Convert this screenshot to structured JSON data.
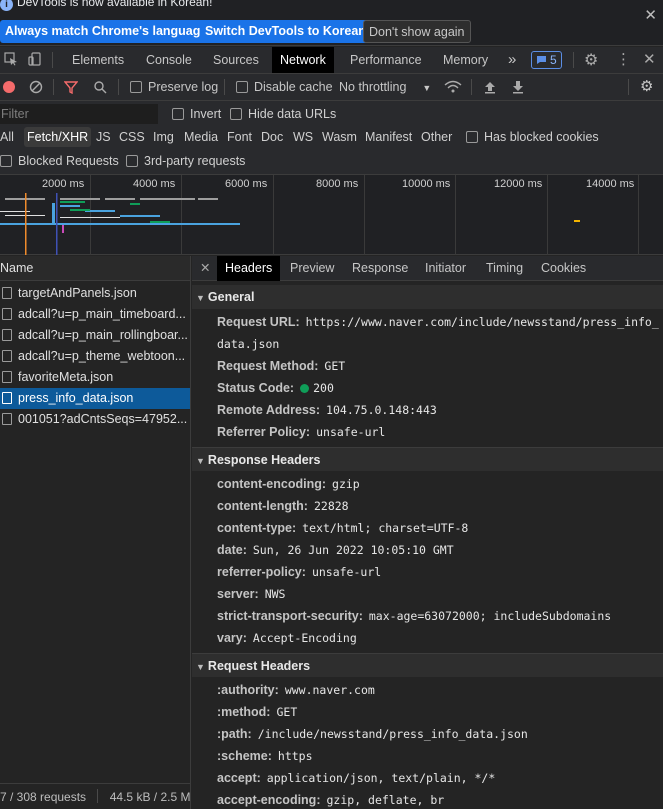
{
  "infobar": {
    "message": "DevTools is now available in Korean!",
    "btn_match": "Always match Chrome's language",
    "btn_switch": "Switch DevTools to Korean",
    "btn_dont": "Don't show again",
    "close": "✕"
  },
  "tabs": {
    "elements": "Elements",
    "console": "Console",
    "sources": "Sources",
    "network": "Network",
    "performance": "Performance",
    "memory": "Memory",
    "more": "»",
    "issues_count": "5"
  },
  "toolbar": {
    "preserve_log": "Preserve log",
    "disable_cache": "Disable cache",
    "throttling": "No throttling"
  },
  "filter": {
    "placeholder": "Filter",
    "invert": "Invert",
    "hide_data_urls": "Hide data URLs",
    "types": [
      "All",
      "Fetch/XHR",
      "JS",
      "CSS",
      "Img",
      "Media",
      "Font",
      "Doc",
      "WS",
      "Wasm",
      "Manifest",
      "Other"
    ],
    "has_blocked_cookies": "Has blocked cookies",
    "blocked_requests": "Blocked Requests",
    "third_party": "3rd-party requests"
  },
  "overview": {
    "ticks": [
      "2000 ms",
      "4000 ms",
      "6000 ms",
      "8000 ms",
      "10000 ms",
      "12000 ms",
      "14000 ms"
    ]
  },
  "requests": {
    "header": "Name",
    "rows": [
      "targetAndPanels.json",
      "adcall?u=p_main_timeboard...",
      "adcall?u=p_main_rollingboar...",
      "adcall?u=p_theme_webtoon...",
      "favoriteMeta.json",
      "press_info_data.json",
      "001051?adCntsSeqs=47952..."
    ],
    "status": "7 / 308 requests",
    "size": "44.5 kB / 2.5 M"
  },
  "details": {
    "tabs": [
      "Headers",
      "Preview",
      "Response",
      "Initiator",
      "Timing",
      "Cookies"
    ],
    "general_title": "General",
    "general": [
      {
        "k": "Request URL:",
        "v": "https://www.naver.com/include/newsstand/press_info_data.json"
      },
      {
        "k": "Request Method:",
        "v": "GET"
      },
      {
        "k": "Status Code:",
        "v": "200"
      },
      {
        "k": "Remote Address:",
        "v": "104.75.0.148:443"
      },
      {
        "k": "Referrer Policy:",
        "v": "unsafe-url"
      }
    ],
    "response_title": "Response Headers",
    "response": [
      {
        "k": "content-encoding:",
        "v": "gzip"
      },
      {
        "k": "content-length:",
        "v": "22828"
      },
      {
        "k": "content-type:",
        "v": "text/html; charset=UTF-8"
      },
      {
        "k": "date:",
        "v": "Sun, 26 Jun 2022 10:05:10 GMT"
      },
      {
        "k": "referrer-policy:",
        "v": "unsafe-url"
      },
      {
        "k": "server:",
        "v": "NWS"
      },
      {
        "k": "strict-transport-security:",
        "v": "max-age=63072000; includeSubdomains"
      },
      {
        "k": "vary:",
        "v": "Accept-Encoding"
      }
    ],
    "request_title": "Request Headers",
    "request": [
      {
        "k": ":authority:",
        "v": "www.naver.com"
      },
      {
        "k": ":method:",
        "v": "GET"
      },
      {
        "k": ":path:",
        "v": "/include/newsstand/press_info_data.json"
      },
      {
        "k": ":scheme:",
        "v": "https"
      },
      {
        "k": "accept:",
        "v": "application/json, text/plain, */*"
      },
      {
        "k": "accept-encoding:",
        "v": "gzip, deflate, br"
      }
    ]
  }
}
